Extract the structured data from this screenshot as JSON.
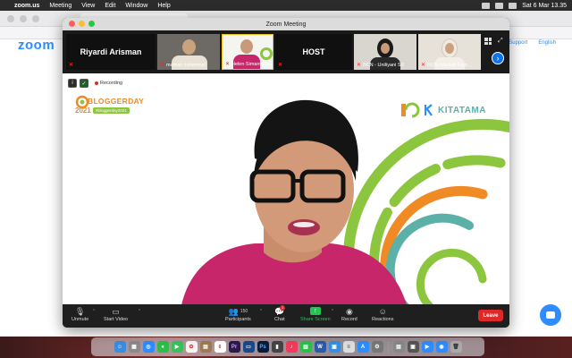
{
  "menubar": {
    "app": "zoom.us",
    "items": [
      "Meeting",
      "View",
      "Edit",
      "Window",
      "Help"
    ],
    "clock": "Sat 6 Mar  13.35"
  },
  "browser": {
    "logo": "zoom",
    "links": [
      "Support",
      "English"
    ]
  },
  "window": {
    "title": "Zoom Meeting"
  },
  "gallery": [
    {
      "name": "Riyardi Arisman",
      "kind": "name-only"
    },
    {
      "name": "maman suherman",
      "kind": "video"
    },
    {
      "name": "Helen Simarmata",
      "kind": "video"
    },
    {
      "name": "HOST",
      "kind": "name-only"
    },
    {
      "name": "BCN - Uniliyani SD",
      "kind": "video"
    },
    {
      "name": "BCN-Wardah Fajri...",
      "kind": "video"
    }
  ],
  "overlay": {
    "recording": "Recording"
  },
  "banner": {
    "event_title": "BLOGGERDAY",
    "event_year": "2021",
    "event_tag": "#bloggerday2021",
    "partner": "KITATAMA"
  },
  "toolbar": {
    "unmute": "Unmute",
    "start_video": "Start Video",
    "participants": "Participants",
    "participants_count": "150",
    "chat": "Chat",
    "chat_badge": "1",
    "share_screen": "Share Screen",
    "record": "Record",
    "reactions": "Reactions",
    "leave": "Leave"
  },
  "colors": {
    "zoom_blue": "#2d8cff",
    "share_green": "#23c552",
    "leave_red": "#e02828",
    "brand_orange": "#f08a24",
    "brand_green": "#8cc63f"
  }
}
